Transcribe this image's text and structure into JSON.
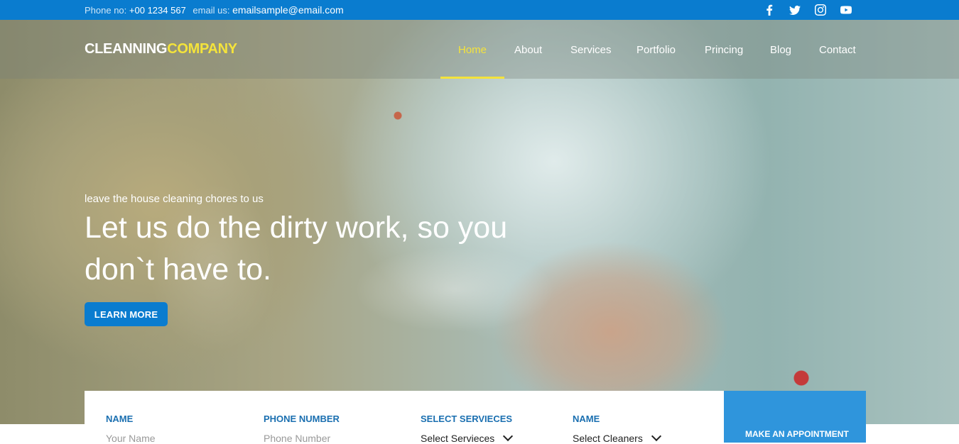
{
  "topbar": {
    "phone_label": "Phone no:",
    "phone_value": "+00 1234 567",
    "email_label": "email us:",
    "email_value": "emailsample@email.com",
    "socials": [
      "facebook-icon",
      "twitter-icon",
      "instagram-icon",
      "youtube-icon"
    ],
    "background": "#0a7ccf"
  },
  "brand": {
    "name_part1": "CLEANNING",
    "name_part2": "COMPANY",
    "accent_color": "#f4e33b"
  },
  "nav": {
    "items": [
      {
        "label": "Home",
        "active": true
      },
      {
        "label": "About"
      },
      {
        "label": "Services"
      },
      {
        "label": "Portfolio"
      },
      {
        "label": "Princing"
      },
      {
        "label": "Blog"
      },
      {
        "label": "Contact"
      }
    ]
  },
  "hero": {
    "kicker": "leave the house cleaning chores to us",
    "headline": "Let us do the dirty work, so you don`t have to.",
    "cta_label": "LEARN MORE"
  },
  "appointment": {
    "fields": [
      {
        "label": "NAME",
        "placeholder": "Your Name"
      },
      {
        "label": "PHONE NUMBER",
        "placeholder": "Phone Number"
      },
      {
        "label": "SELECT SERVIECES",
        "selected": "Select Servieces"
      },
      {
        "label": "NAME",
        "selected": "Select Cleaners"
      }
    ],
    "submit_label": "MAKE AN APPOINTMENT",
    "submit_color": "#2f95dc"
  }
}
